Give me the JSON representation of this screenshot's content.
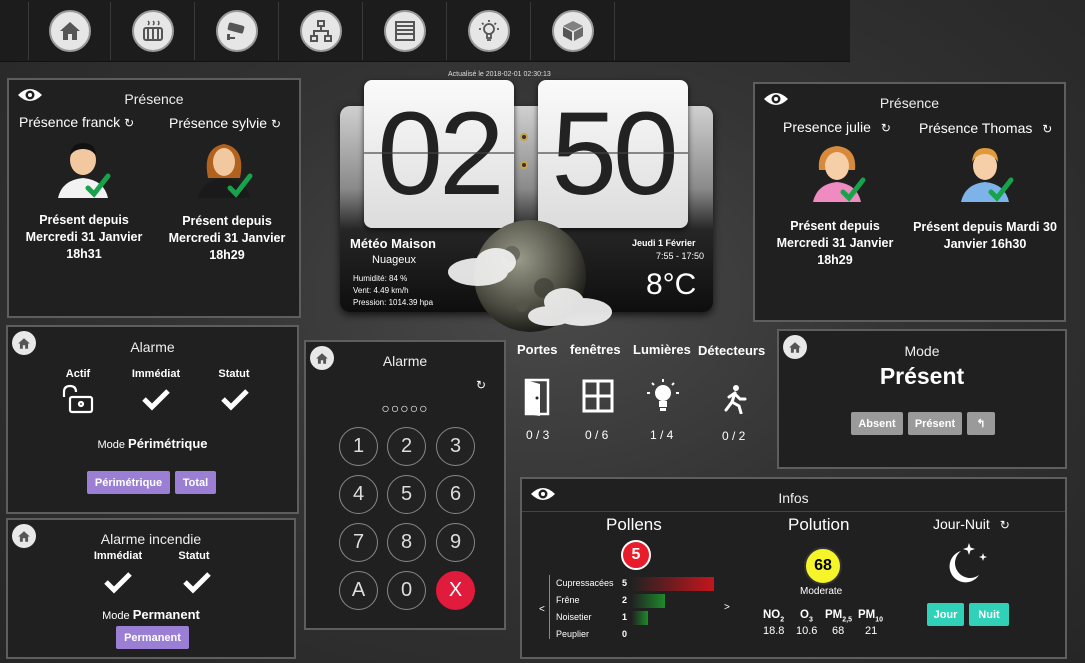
{
  "nav": {
    "icons": [
      "home-icon",
      "heating-icon",
      "camera-icon",
      "network-icon",
      "shutter-icon",
      "lightbulb-icon",
      "box-icon"
    ]
  },
  "presence_left": {
    "title": "Présence",
    "persons": [
      {
        "name": "Présence franck",
        "line1": "Présent depuis",
        "line2": "Mercredi 31 Janvier",
        "line3": "18h31"
      },
      {
        "name": "Présence sylvie",
        "line1": "Présent depuis",
        "line2": "Mercredi 31 Janvier",
        "line3": "18h29"
      }
    ]
  },
  "presence_right": {
    "title": "Présence",
    "persons": [
      {
        "name": "Presence julie",
        "line1": "Présent depuis",
        "line2": "Mercredi 31 Janvier",
        "line3": "18h29"
      },
      {
        "name": "Présence Thomas",
        "line1": "Présent depuis Mardi 30",
        "line2": "Janvier 16h30",
        "line3": ""
      }
    ]
  },
  "clock": {
    "updated": "Actualisé le 2018-02-01 02:30:13",
    "hours": "02",
    "minutes": "50",
    "weather_title": "Météo Maison",
    "condition": "Nuageux",
    "humidity": "Humidité: 84 %",
    "wind": "Vent: 4.49 km/h",
    "pressure": "Pression: 1014.39 hpa",
    "date": "Jeudi 1 Février",
    "sun": "7:55 - 17:50",
    "temp": "8°C"
  },
  "alarme": {
    "title": "Alarme",
    "cols": [
      "Actif",
      "Immédiat",
      "Statut"
    ],
    "mode_prefix": "Mode",
    "mode_value": "Périmétrique",
    "buttons": [
      "Périmétrique",
      "Total"
    ]
  },
  "incendie": {
    "title": "Alarme incendie",
    "cols": [
      "Immédiat",
      "Statut"
    ],
    "mode_prefix": "Mode",
    "mode_value": "Permanent",
    "button": "Permanent"
  },
  "keypad": {
    "title": "Alarme",
    "code": "○○○○○",
    "keys": [
      "1",
      "2",
      "3",
      "4",
      "5",
      "6",
      "7",
      "8",
      "9",
      "A",
      "0",
      "X"
    ]
  },
  "sensors": {
    "labels": [
      "Portes",
      "fenêtres",
      "Lumières",
      "Détecteurs"
    ],
    "counts": [
      "0 / 3",
      "0 / 6",
      "1 / 4",
      "0 / 2"
    ]
  },
  "mode": {
    "title": "Mode",
    "value": "Présent",
    "buttons": [
      "Absent",
      "Présent"
    ]
  },
  "infos": {
    "title": "Infos",
    "pollens": {
      "title": "Pollens",
      "level": "5",
      "rows": [
        {
          "name": "Cupressacées",
          "value": 5,
          "color": "#c4151c"
        },
        {
          "name": "Frêne",
          "value": 2,
          "color": "#1d8a2a"
        },
        {
          "name": "Noisetier",
          "value": 1,
          "color": "#1d8a2a"
        },
        {
          "name": "Peuplier",
          "value": 0,
          "color": "#1d8a2a"
        }
      ],
      "max": 5,
      "prev": "<",
      "next": ">"
    },
    "pollution": {
      "title": "Polution",
      "aqi": "68",
      "label": "Moderate",
      "names": [
        "NO",
        "O",
        "PM",
        "PM"
      ],
      "subs": [
        "2",
        "3",
        "2,5",
        "10"
      ],
      "values": [
        "18.8",
        "10.6",
        "68",
        "21"
      ]
    },
    "jour_nuit": {
      "title": "Jour-Nuit",
      "buttons": [
        "Jour",
        "Nuit"
      ]
    }
  }
}
